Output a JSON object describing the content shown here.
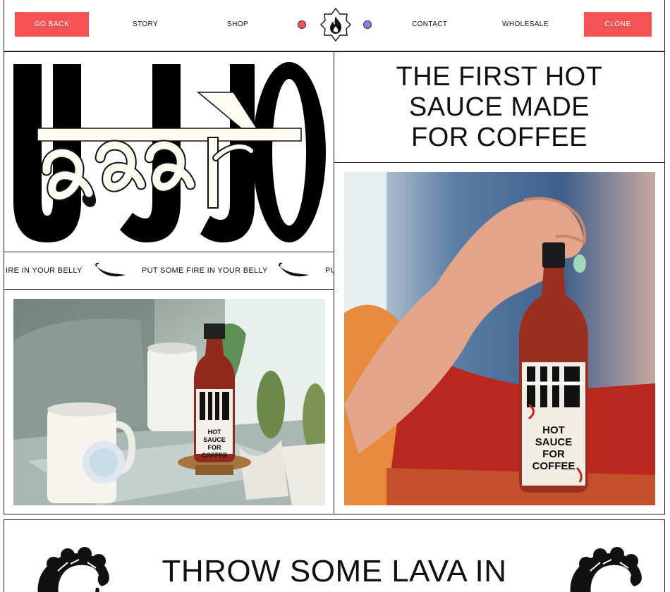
{
  "nav": {
    "go_back": "GO BACK",
    "story": "STORY",
    "shop": "SHOP",
    "contact": "CONTACT",
    "wholesale": "WHOLESALE",
    "clone": "CLONE"
  },
  "ticker": {
    "items": [
      "IRE IN YOUR BELLY",
      "PUT SOME FIRE IN YOUR BELLY",
      "PU"
    ]
  },
  "hero": {
    "headline": "THE FIRST HOT SAUCE MADE FOR COFFEE"
  },
  "product_photos": {
    "bottle_label_brand": "UJJO",
    "bottle_label_text": "HOT SAUCE FOR COFFEE"
  },
  "bottom": {
    "headline": "THROW SOME LAVA IN"
  },
  "colors": {
    "accent_red": "#f55353",
    "dot_red": "#f05353",
    "dot_purple": "#8a7cf0"
  },
  "icons": [
    "flame-logo-icon",
    "chili-pepper-icon",
    "scorpion-icon"
  ]
}
